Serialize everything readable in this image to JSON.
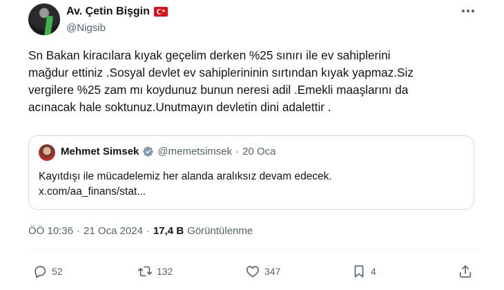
{
  "author": {
    "display_name": "Av. Çetin Bişgin",
    "handle": "@Nigsib",
    "flag_icon": "turkey-flag-icon"
  },
  "tweet": {
    "lines": [
      "Sn Bakan kiracılara kıyak geçelim derken %25 sınırı ile ev sahiplerini",
      "mağdur ettiniz .Sosyal devlet ev sahiplerininin sırtından kıyak yapmaz.Siz",
      "vergilere %25 zam mı koydunuz bunun neresi adil .Emekli maaşlarını da",
      "acınacak hale soktunuz.Unutmayın devletin dini adalettir ."
    ]
  },
  "quote": {
    "name": "Mehmet Simsek",
    "handle": "@memetsimsek",
    "separator": "·",
    "date": "20 Oca",
    "text_line1": "Kayıtdışı ile mücadelemiz her alanda aralıksız devam edecek.",
    "text_line2": "x.com/aa_finans/stat..."
  },
  "meta": {
    "time": "ÖÖ 10:36",
    "separator": "·",
    "date": "21 Oca 2024",
    "views_count": "17,4 B",
    "views_label": "Görüntülenme"
  },
  "actions": {
    "replies": "52",
    "retweets": "132",
    "likes": "347",
    "bookmarks": "4"
  },
  "colors": {
    "text_primary": "#0f1419",
    "text_secondary": "#536471",
    "verified_badge": "#829aab",
    "border": "#cfd9de"
  }
}
